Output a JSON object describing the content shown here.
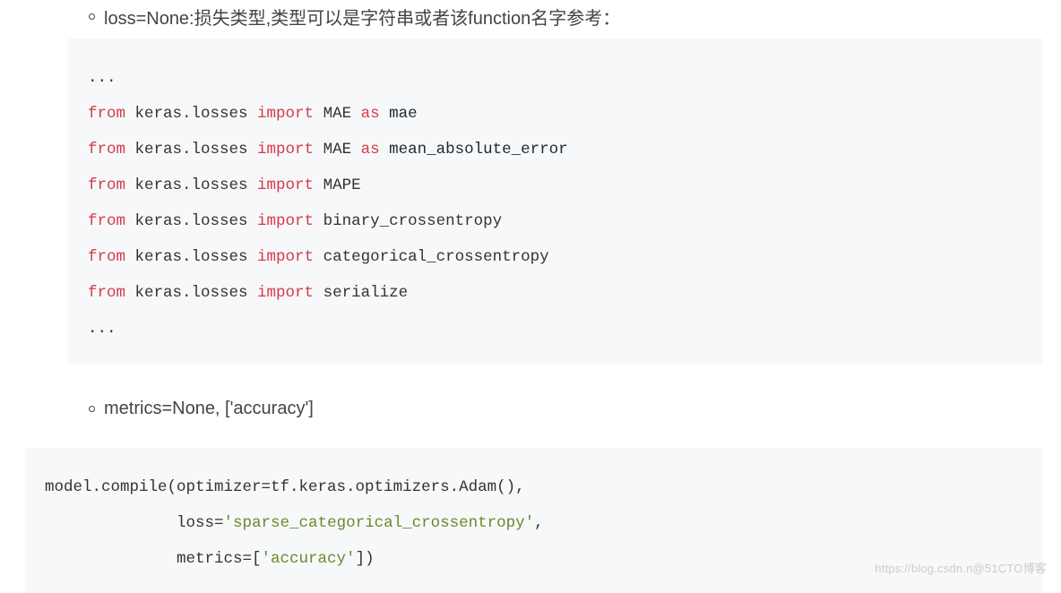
{
  "bullet1": "loss=None:损失类型,类型可以是字符串或者该function名字参考：",
  "bullet2": "metrics=None, ['accuracy']",
  "code1": {
    "l0": "...",
    "l1p1": "from",
    "l1p2": " keras.losses ",
    "l1p3": "import",
    "l1p4": " MAE ",
    "l1p5": "as",
    "l1p6": " mae",
    "l2p1": "from",
    "l2p2": " keras.losses ",
    "l2p3": "import",
    "l2p4": " MAE ",
    "l2p5": "as",
    "l2p6": " mean_absolute_error",
    "l3p1": "from",
    "l3p2": " keras.losses ",
    "l3p3": "import",
    "l3p4": " MAPE",
    "l4p1": "from",
    "l4p2": " keras.losses ",
    "l4p3": "import",
    "l4p4": " binary_crossentropy",
    "l5p1": "from",
    "l5p2": " keras.losses ",
    "l5p3": "import",
    "l5p4": " categorical_crossentropy",
    "l6p1": "from",
    "l6p2": " keras.losses ",
    "l6p3": "import",
    "l6p4": " serialize",
    "l7": "..."
  },
  "code2": {
    "l1": "model.compile(optimizer=tf.keras.optimizers.Adam(),",
    "l2a": "              loss=",
    "l2b": "'sparse_categorical_crossentropy'",
    "l2c": ",",
    "l3a": "              metrics=[",
    "l3b": "'accuracy'",
    "l3c": "])"
  },
  "watermark": "https://blog.csdn.n@51CTO博客"
}
